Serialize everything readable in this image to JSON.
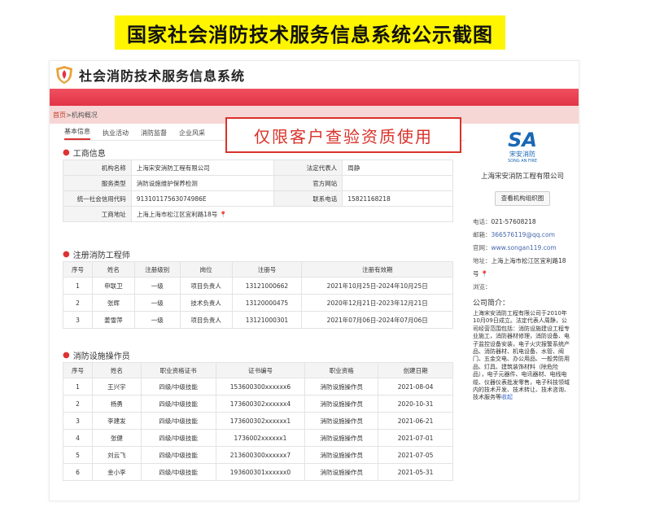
{
  "banner": "国家社会消防技术服务信息系统公示截图",
  "site": {
    "title": "社会消防技术服务信息系统"
  },
  "breadcrumb": {
    "home": "首页",
    "sep": " > ",
    "current": "机构概况"
  },
  "tabs": [
    "基本信息",
    "执业活动",
    "消防监督",
    "企业风采"
  ],
  "stamp": "仅限客户查验资质使用",
  "business": {
    "title": "工商信息",
    "rows": [
      [
        "机构名称",
        "上海宋安消防工程有限公司",
        "法定代表人",
        "周静"
      ],
      [
        "服务类型",
        "消防设施维护保养检测",
        "官方网站",
        ""
      ],
      [
        "统一社会信用代码",
        "91310117563074986E",
        "联系电话",
        "15821168218"
      ]
    ],
    "address_label": "工商地址",
    "address": "上海上海市松江区宜利路18号"
  },
  "engineers": {
    "title": "注册消防工程师",
    "headers": [
      "序号",
      "姓名",
      "注册级别",
      "岗位",
      "注册号",
      "注册有效期"
    ],
    "rows": [
      [
        "1",
        "申联卫",
        "一级",
        "项目负责人",
        "13121000662",
        "2021年10月25日-2024年10月25日"
      ],
      [
        "2",
        "张辉",
        "一级",
        "技术负责人",
        "13120000475",
        "2020年12月21日-2023年12月21日"
      ],
      [
        "3",
        "姜雪萍",
        "一级",
        "项目负责人",
        "13121000301",
        "2021年07月06日-2024年07月06日"
      ]
    ]
  },
  "operators": {
    "title": "消防设施操作员",
    "headers": [
      "序号",
      "姓名",
      "职业资格证书",
      "证书编号",
      "职业资格",
      "创建日期"
    ],
    "rows": [
      [
        "1",
        "王兴宇",
        "四级/中级技能",
        "153600300xxxxxx6",
        "消防设施操作员",
        "2021-08-04"
      ],
      [
        "2",
        "杨勇",
        "四级/中级技能",
        "173600302xxxxxx4",
        "消防设施操作员",
        "2020-10-31"
      ],
      [
        "3",
        "李建发",
        "四级/中级技能",
        "173600302xxxxxx1",
        "消防设施操作员",
        "2021-06-21"
      ],
      [
        "4",
        "张健",
        "四级/中级技能",
        "1736002xxxxxx1",
        "消防设施操作员",
        "2021-07-01"
      ],
      [
        "5",
        "刘云飞",
        "四级/中级技能",
        "213600300xxxxxx7",
        "消防设施操作员",
        "2021-07-05"
      ],
      [
        "6",
        "金小李",
        "四级/中级技能",
        "193600301xxxxxx0",
        "消防设施操作员",
        "2021-05-31"
      ]
    ]
  },
  "sidebar": {
    "logo_text": "SA",
    "logo_cn": "宋安消防",
    "logo_en": "SONG AN FIRE",
    "company_name": "上海宋安消防工程有限公司",
    "org_chart_button": "查看机构组织图",
    "phone_label": "电话：",
    "phone": "021-57608218",
    "email_label": "邮箱：",
    "email": "366576119@qq.com",
    "web_label": "官网：",
    "web": "www.songan119.com",
    "addr_label": "地址：",
    "addr": "上海上海市松江区宜利路18号",
    "views_label": "浏览：",
    "intro_title": "公司简介：",
    "intro": "上海宋安消防工程有限公司于2010年10月09日成立。法定代表人周静，公司经营范围包括：消防设施建设工程专业施工，消防器材修理，消防设备、电子监控设备安装，电子火灾报警系统产品、消防器材、机电设备、水管、阀门、五金交电、办公用品、一般劳防用品、灯具、建筑装饰材料（除危险品），电子元器件、电讯器材、电线电缆、仪器仪表批发零售，电子科技领域内的技术开发、技术转让、技术咨询、技术服务等",
    "intro_more": "收起"
  },
  "colors": {
    "accent": "#e23346",
    "banner_bg": "#fff500",
    "stamp": "#d9322a",
    "brand_blue": "#1a67b4"
  }
}
